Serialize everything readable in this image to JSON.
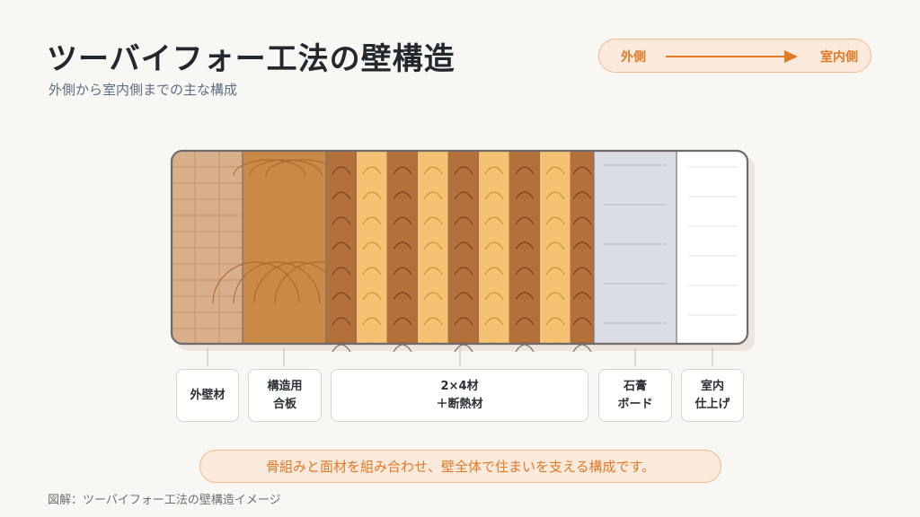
{
  "title": "ツーバイフォー工法の壁構造",
  "subtitle": "外側から室内側までの主な構成",
  "direction": {
    "from": "外側",
    "to": "室内側"
  },
  "layers": [
    {
      "id": "exterior",
      "lines": [
        "外壁材"
      ],
      "color": "#d9ae8a"
    },
    {
      "id": "plywood",
      "lines": [
        "構造用",
        "合板"
      ],
      "color": "#c98a47"
    },
    {
      "id": "studs",
      "lines": [
        "2×4材",
        "＋断熱材"
      ],
      "stud_color": "#b3703a",
      "insulation_color": "#f4c272"
    },
    {
      "id": "gypsum",
      "lines": [
        "石膏",
        "ボード"
      ],
      "color": "#dadde6"
    },
    {
      "id": "interior",
      "lines": [
        "室内",
        "仕上げ"
      ],
      "color": "#ffffff"
    }
  ],
  "note": "骨組みと面材を組み合わせ、壁全体で住まいを支える構成です。",
  "caption": "図解：ツーバイフォー工法の壁構造イメージ",
  "colors": {
    "accent": "#e07a28",
    "accent_bg": "#fbeadb",
    "outline": "#6f6a67",
    "leader": "#c9c3bb"
  }
}
